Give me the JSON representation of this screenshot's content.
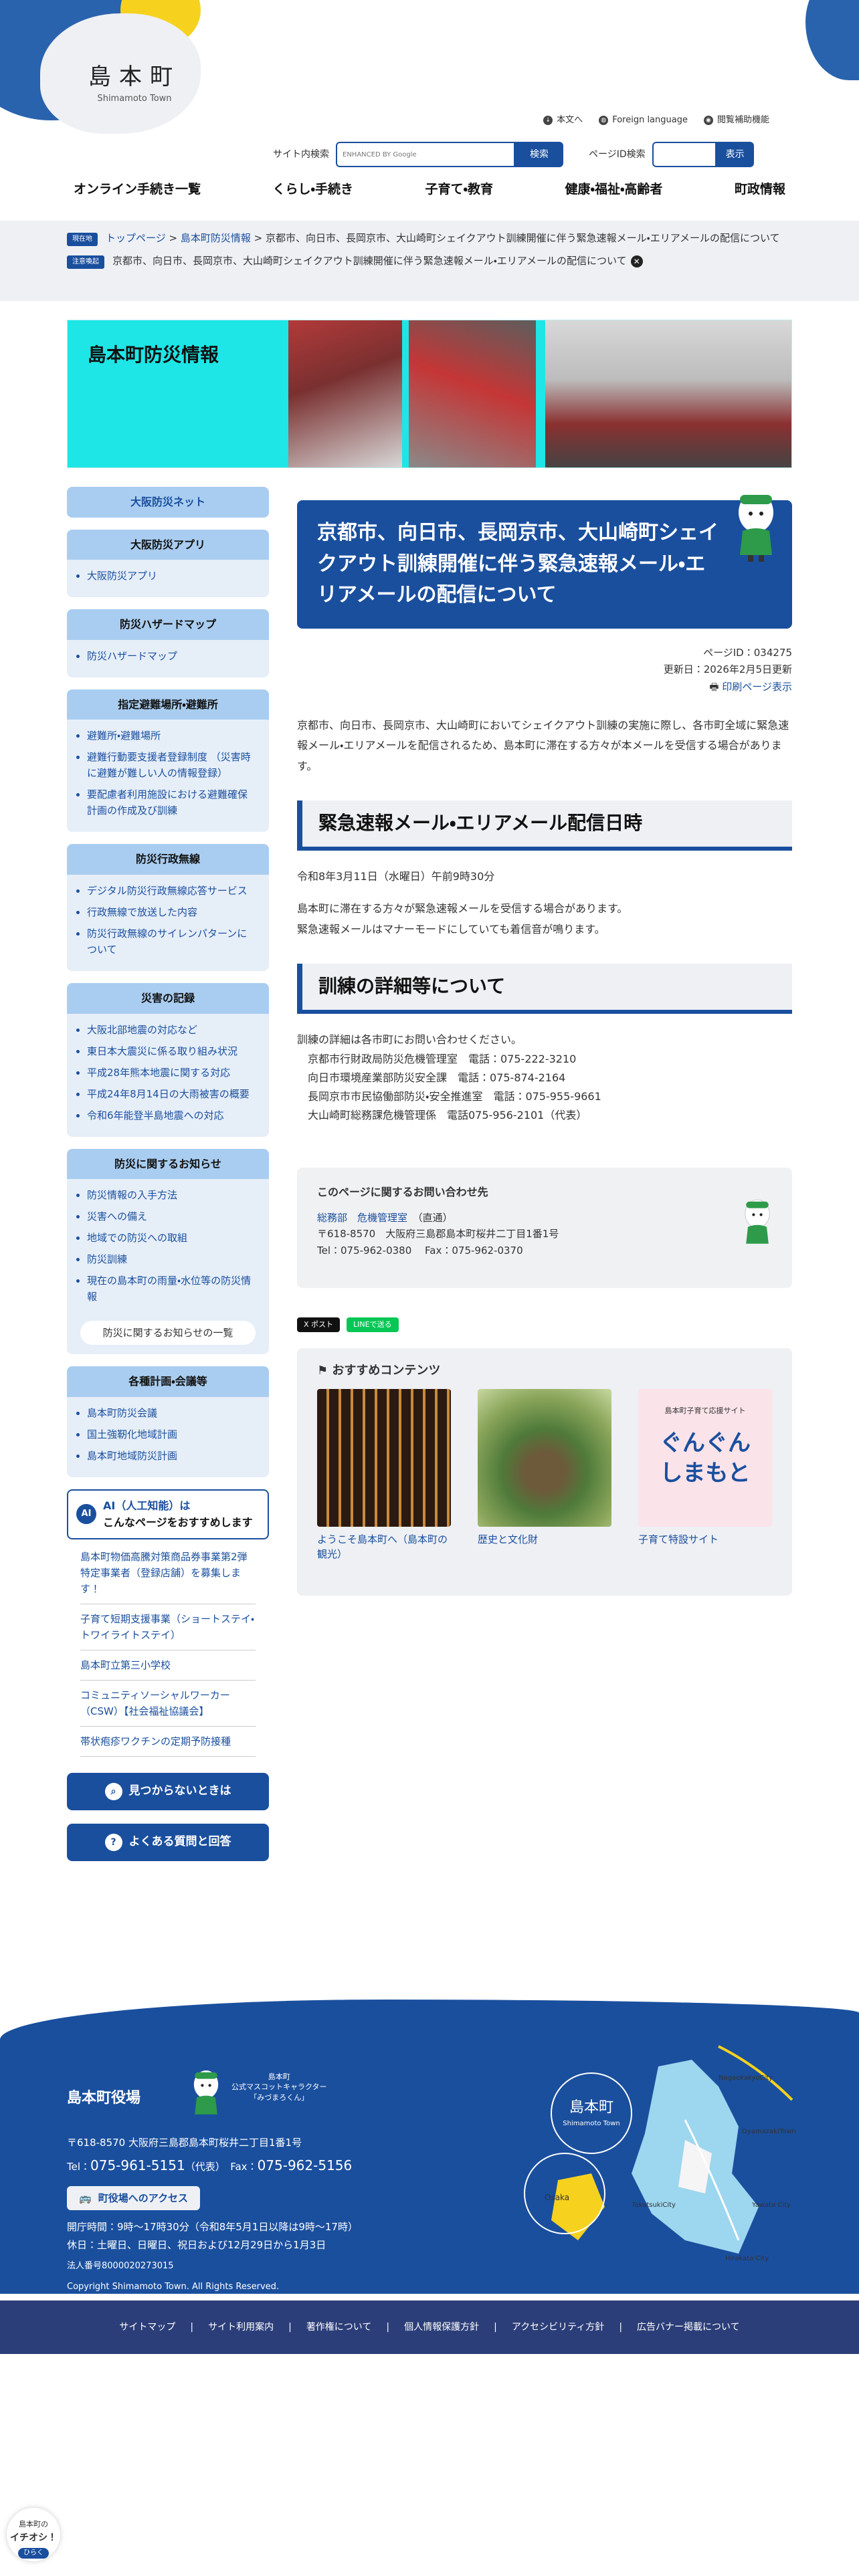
{
  "site": {
    "logo_jp": "島本町",
    "logo_en": "Shimamoto Town"
  },
  "util": {
    "text_size": "本文へ",
    "foreign": "Foreign language",
    "assist": "閲覧補助機能"
  },
  "search": {
    "label": "サイト内検索",
    "placeholder": "ENHANCED BY Google",
    "button": "検索",
    "pageid_label": "ページID検索",
    "pageid_button": "表示"
  },
  "gnav": [
    "オンライン手続き一覧",
    "くらし・手続き",
    "子育て・教育",
    "健康・福祉・高齢者",
    "町政情報"
  ],
  "breadcrumb": {
    "tag_current": "現在地",
    "home": "トップページ",
    "parent": "島本町防災情報",
    "current": "京都市、向日市、長岡京市、大山崎町シェイクアウト訓練開催に伴う緊急速報メール・エリアメールの配信について",
    "tag_alert": "注意喚起",
    "alert": "京都市、向日市、長岡京市、大山崎町シェイクアウト訓練開催に伴う緊急速報メール・エリアメールの配信について"
  },
  "banner": {
    "title": "島本町防災情報"
  },
  "sidebar": {
    "top_link": "大阪防災ネット",
    "sections": [
      {
        "title": "大阪防災アプリ",
        "items": [
          "大阪防災アプリ"
        ]
      },
      {
        "title": "防災ハザードマップ",
        "items": [
          "防災ハザードマップ"
        ]
      },
      {
        "title": "指定避難場所・避難所",
        "items": [
          "避難所・避難場所",
          "避難行動要支援者登録制度 （災害時に避難が難しい人の情報登録）",
          "要配慮者利用施設における避難確保計画の作成及び訓練"
        ]
      },
      {
        "title": "防災行政無線",
        "items": [
          "デジタル防災行政無線応答サービス",
          "行政無線で放送した内容",
          "防災行政無線のサイレンパターンについて"
        ]
      },
      {
        "title": "災害の記録",
        "items": [
          "大阪北部地震の対応など",
          "東日本大震災に係る取り組み状況",
          "平成28年熊本地震に関する対応",
          "平成24年8月14日の大雨被害の概要",
          "令和6年能登半島地震への対応"
        ]
      },
      {
        "title": "防災に関するお知らせ",
        "items": [
          "防災情報の入手方法",
          "災害への備え",
          "地域での防災への取組",
          "防災訓練",
          "現在の島本町の雨量・水位等の防災情報"
        ],
        "more": "防災に関するお知らせの一覧"
      },
      {
        "title": "各種計画・会議等",
        "items": [
          "島本町防災会議",
          "国土強靭化地域計画",
          "島本町地域防災計画"
        ]
      }
    ],
    "ai_icon": "AI",
    "ai_title": "AI（人工知能）は",
    "ai_sub": "こんなページをおすすめします",
    "recommend": [
      "島本町物価高騰対策商品券事業第2弾特定事業者（登録店舗）を募集します！",
      "子育て短期支援事業（ショートステイ・トワイライトステイ）",
      "島本町立第三小学校",
      "コミュニティソーシャルワーカー（CSW）【社会福祉協議会】",
      "帯状疱疹ワクチンの定期予防接種"
    ],
    "btn_notfound": "見つからないときは",
    "btn_faq": "よくある質問と回答"
  },
  "main": {
    "title": "京都市、向日市、長岡京市、大山崎町シェイクアウト訓練開催に伴う緊急速報メール・エリアメールの配信について",
    "page_id": "ページID：034275",
    "updated": "更新日：2026年2月5日更新",
    "print": "印刷ページ表示",
    "lead": "京都市、向日市、長岡京市、大山崎町においてシェイクアウト訓練の実施に際し、各市町全域に緊急速報メール・エリアメールを配信されるため、島本町に滞在する方々が本メールを受信する場合があります。",
    "h2_1": "緊急速報メール・エリアメール配信日時",
    "date": "令和8年3月11日（水曜日）午前9時30分",
    "note1": "島本町に滞在する方々が緊急速報メールを受信する場合があります。",
    "note2": "緊急速報メールはマナーモードにしていても着信音が鳴ります。",
    "h2_2": "訓練の詳細等について",
    "detail_intro": "訓練の詳細は各市町にお問い合わせください。",
    "contacts": [
      "京都市行財政局防災危機管理室　電話：075-222-3210",
      "向日市環境産業部防災安全課　電話：075-874-2164",
      "長岡京市市民協働部防災・安全推進室　電話：075-955-9661",
      "大山崎町総務課危機管理係　電話075-956-2101（代表）"
    ],
    "inquiry": {
      "title": "このページに関するお問い合わせ先",
      "dept": "総務部",
      "section": "危機管理室",
      "direct": "（直通）",
      "address": "〒618-8570　大阪府三島郡島本町桜井二丁目1番1号",
      "tel": "Tel：075-962-0380　 Fax：075-962-0370"
    },
    "sns": {
      "x": "X ポスト",
      "line": "LINEで送る"
    },
    "reco": {
      "title": "おすすめコンテンツ",
      "cards": [
        {
          "label": "ようこそ島本町へ（島本町の観光）"
        },
        {
          "label": "歴史と文化財"
        },
        {
          "label": "子育て特設サイト",
          "img_text1": "島本町子育て応援サイト",
          "img_text2": "ぐんぐん",
          "img_text3": "しまもと"
        }
      ]
    }
  },
  "footer": {
    "name": "島本町役場",
    "mascot_line1": "島本町",
    "mascot_line2": "公式マスコットキャラクター",
    "mascot_line3": "「みづまろくん」",
    "address": "〒618-8570 大阪府三島郡島本町桜井二丁目1番1号",
    "tel_label": "Tel：",
    "tel": "075-961-5151",
    "tel_suffix": "（代表）",
    "fax_label": "Fax：",
    "fax": "075-962-5156",
    "access": "町役場へのアクセス",
    "hours": "開庁時間：9時～17時30分（令和8年5月1日以降は9時～17時）",
    "closed": "休日：土曜日、日曜日、祝日および12月29日から1月3日",
    "corp_no": "法人番号8000020273015",
    "copyright": "Copyright Shimamoto Town. All Rights Reserved.",
    "map": {
      "town_jp": "島本町",
      "town_en": "Shimamoto Town",
      "osaka": "Osaka",
      "nagaokakyo": "NagaokakyoCity",
      "oyamazaki": "OyamazakiTown",
      "takatsuki": "TakatsukiCity",
      "yawata": "Yawata City",
      "hirakata": "Hirakata City"
    },
    "links": [
      "サイトマップ",
      "サイト利用案内",
      "著作権について",
      "個人情報保護方針",
      "アクセシビリティ方針",
      "広告バナー掲載について"
    ]
  },
  "badge": {
    "line1": "島本町の",
    "line2": "イチオシ！",
    "btn": "ひらく"
  },
  "colors": {
    "primary": "#1a4f9e",
    "light": "#a9cdf0",
    "yellow": "#f6d21e",
    "cyan": "#1ee6e6"
  }
}
